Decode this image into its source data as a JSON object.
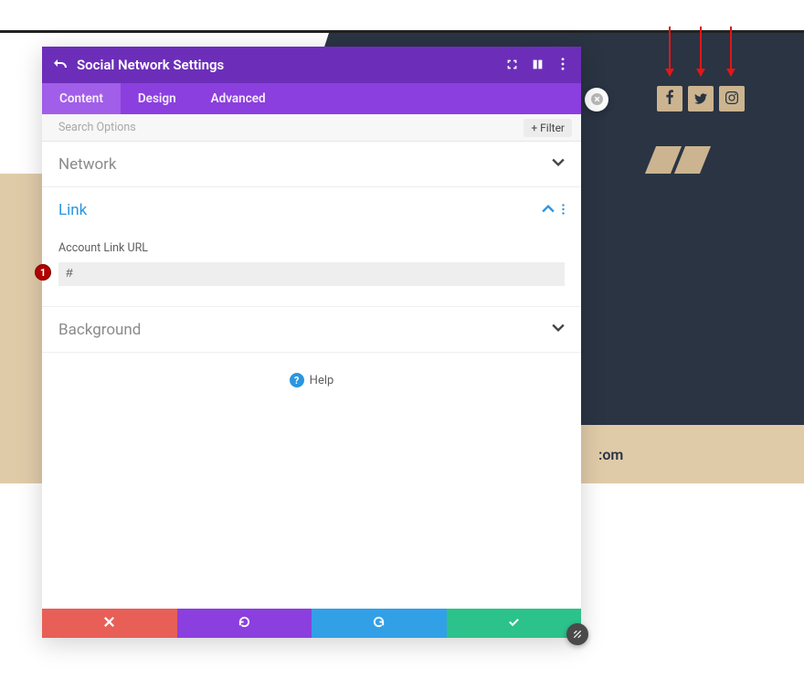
{
  "header": {
    "title": "Social Network Settings"
  },
  "tabs": {
    "content": "Content",
    "design": "Design",
    "advanced": "Advanced"
  },
  "search": {
    "placeholder": "Search Options",
    "filter_label": "Filter"
  },
  "sections": {
    "network": {
      "title": "Network"
    },
    "link": {
      "title": "Link",
      "field_label": "Account Link URL",
      "field_value": "#"
    },
    "background": {
      "title": "Background"
    }
  },
  "annotation": {
    "badge": "1"
  },
  "help": {
    "label": "Help"
  },
  "footer_text": ":om",
  "colors": {
    "purple": "#8b3fde",
    "purple_dark": "#6c2eb9",
    "blue": "#32a0e7",
    "green": "#2cc28c",
    "red": "#e85f57",
    "tan": "#e0cba9",
    "navy": "#2a3443"
  }
}
